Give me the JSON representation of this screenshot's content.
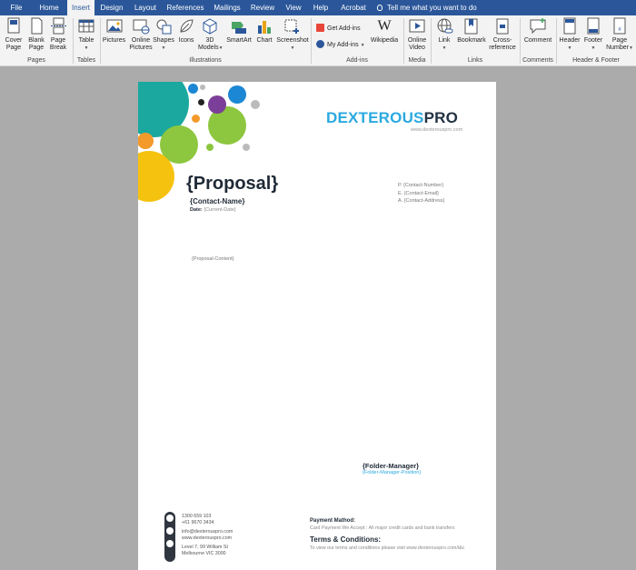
{
  "tabs": [
    {
      "label": "File"
    },
    {
      "label": "Home"
    },
    {
      "label": "Insert"
    },
    {
      "label": "Design"
    },
    {
      "label": "Layout"
    },
    {
      "label": "References"
    },
    {
      "label": "Mailings"
    },
    {
      "label": "Review"
    },
    {
      "label": "View"
    },
    {
      "label": "Help"
    },
    {
      "label": "Acrobat"
    }
  ],
  "active_tab": "Insert",
  "tell_me": "Tell me what you want to do",
  "ribbon": {
    "cover_page": "Cover Page",
    "blank_page": "Blank Page",
    "page_break": "Page Break",
    "table": "Table",
    "pictures": "Pictures",
    "online_pictures": "Online Pictures",
    "shapes": "Shapes",
    "icons": "Icons",
    "models_3d": "3D Models",
    "smartart": "SmartArt",
    "chart": "Chart",
    "screenshot": "Screenshot",
    "get_addins": "Get Add-ins",
    "my_addins": "My Add-ins",
    "wikipedia": "Wikipedia",
    "online_video": "Online Video",
    "link": "Link",
    "bookmark": "Bookmark",
    "cross_reference": "Cross-reference",
    "comment": "Comment",
    "header": "Header",
    "footer": "Footer",
    "page_number": "Page Number",
    "groups": {
      "pages": "Pages",
      "tables": "Tables",
      "illustrations": "Illustrations",
      "addins": "Add-ins",
      "media": "Media",
      "links": "Links",
      "comments": "Comments",
      "header_footer": "Header & Footer"
    }
  },
  "colors": {
    "ribbon_blue": "#2b579a",
    "accent_blue": "#2aa9e0",
    "dark": "#223244"
  },
  "document": {
    "logo_part1": "DEXTEROUS",
    "logo_part2": "PRO",
    "website": "www.dexterouspro.com",
    "title": "{Proposal}",
    "contact_name": "{Contact-Name}",
    "date_label": "Date:",
    "date_value": "{Current-Date}",
    "contact_number": "P. {Contact-Number}",
    "contact_email": "E. {Contact-Email}",
    "contact_address": "A. {Contact-Address}",
    "proposal_content": "{Proposal-Content}",
    "folder_manager": "{Folder-Manager}",
    "folder_manager_position": "{Folder-Manager-Position}",
    "footer": {
      "phone1": "1300 659 103",
      "phone2": "+61 9670 3434",
      "email": "info@dexterouspro.com",
      "web": "www.dexterouspro.com",
      "address1": "Level 7, 99 William St",
      "address2": "Melbourne VIC 3000",
      "payment_heading": "Payment Mathod:",
      "payment_text": "Card Payment We Accept : All major credit cards and bank transfers",
      "terms_heading": "Terms & Conditions:",
      "terms_text": "To view our terms and conditions please visit www.dexterouspro.com/t&c"
    }
  }
}
